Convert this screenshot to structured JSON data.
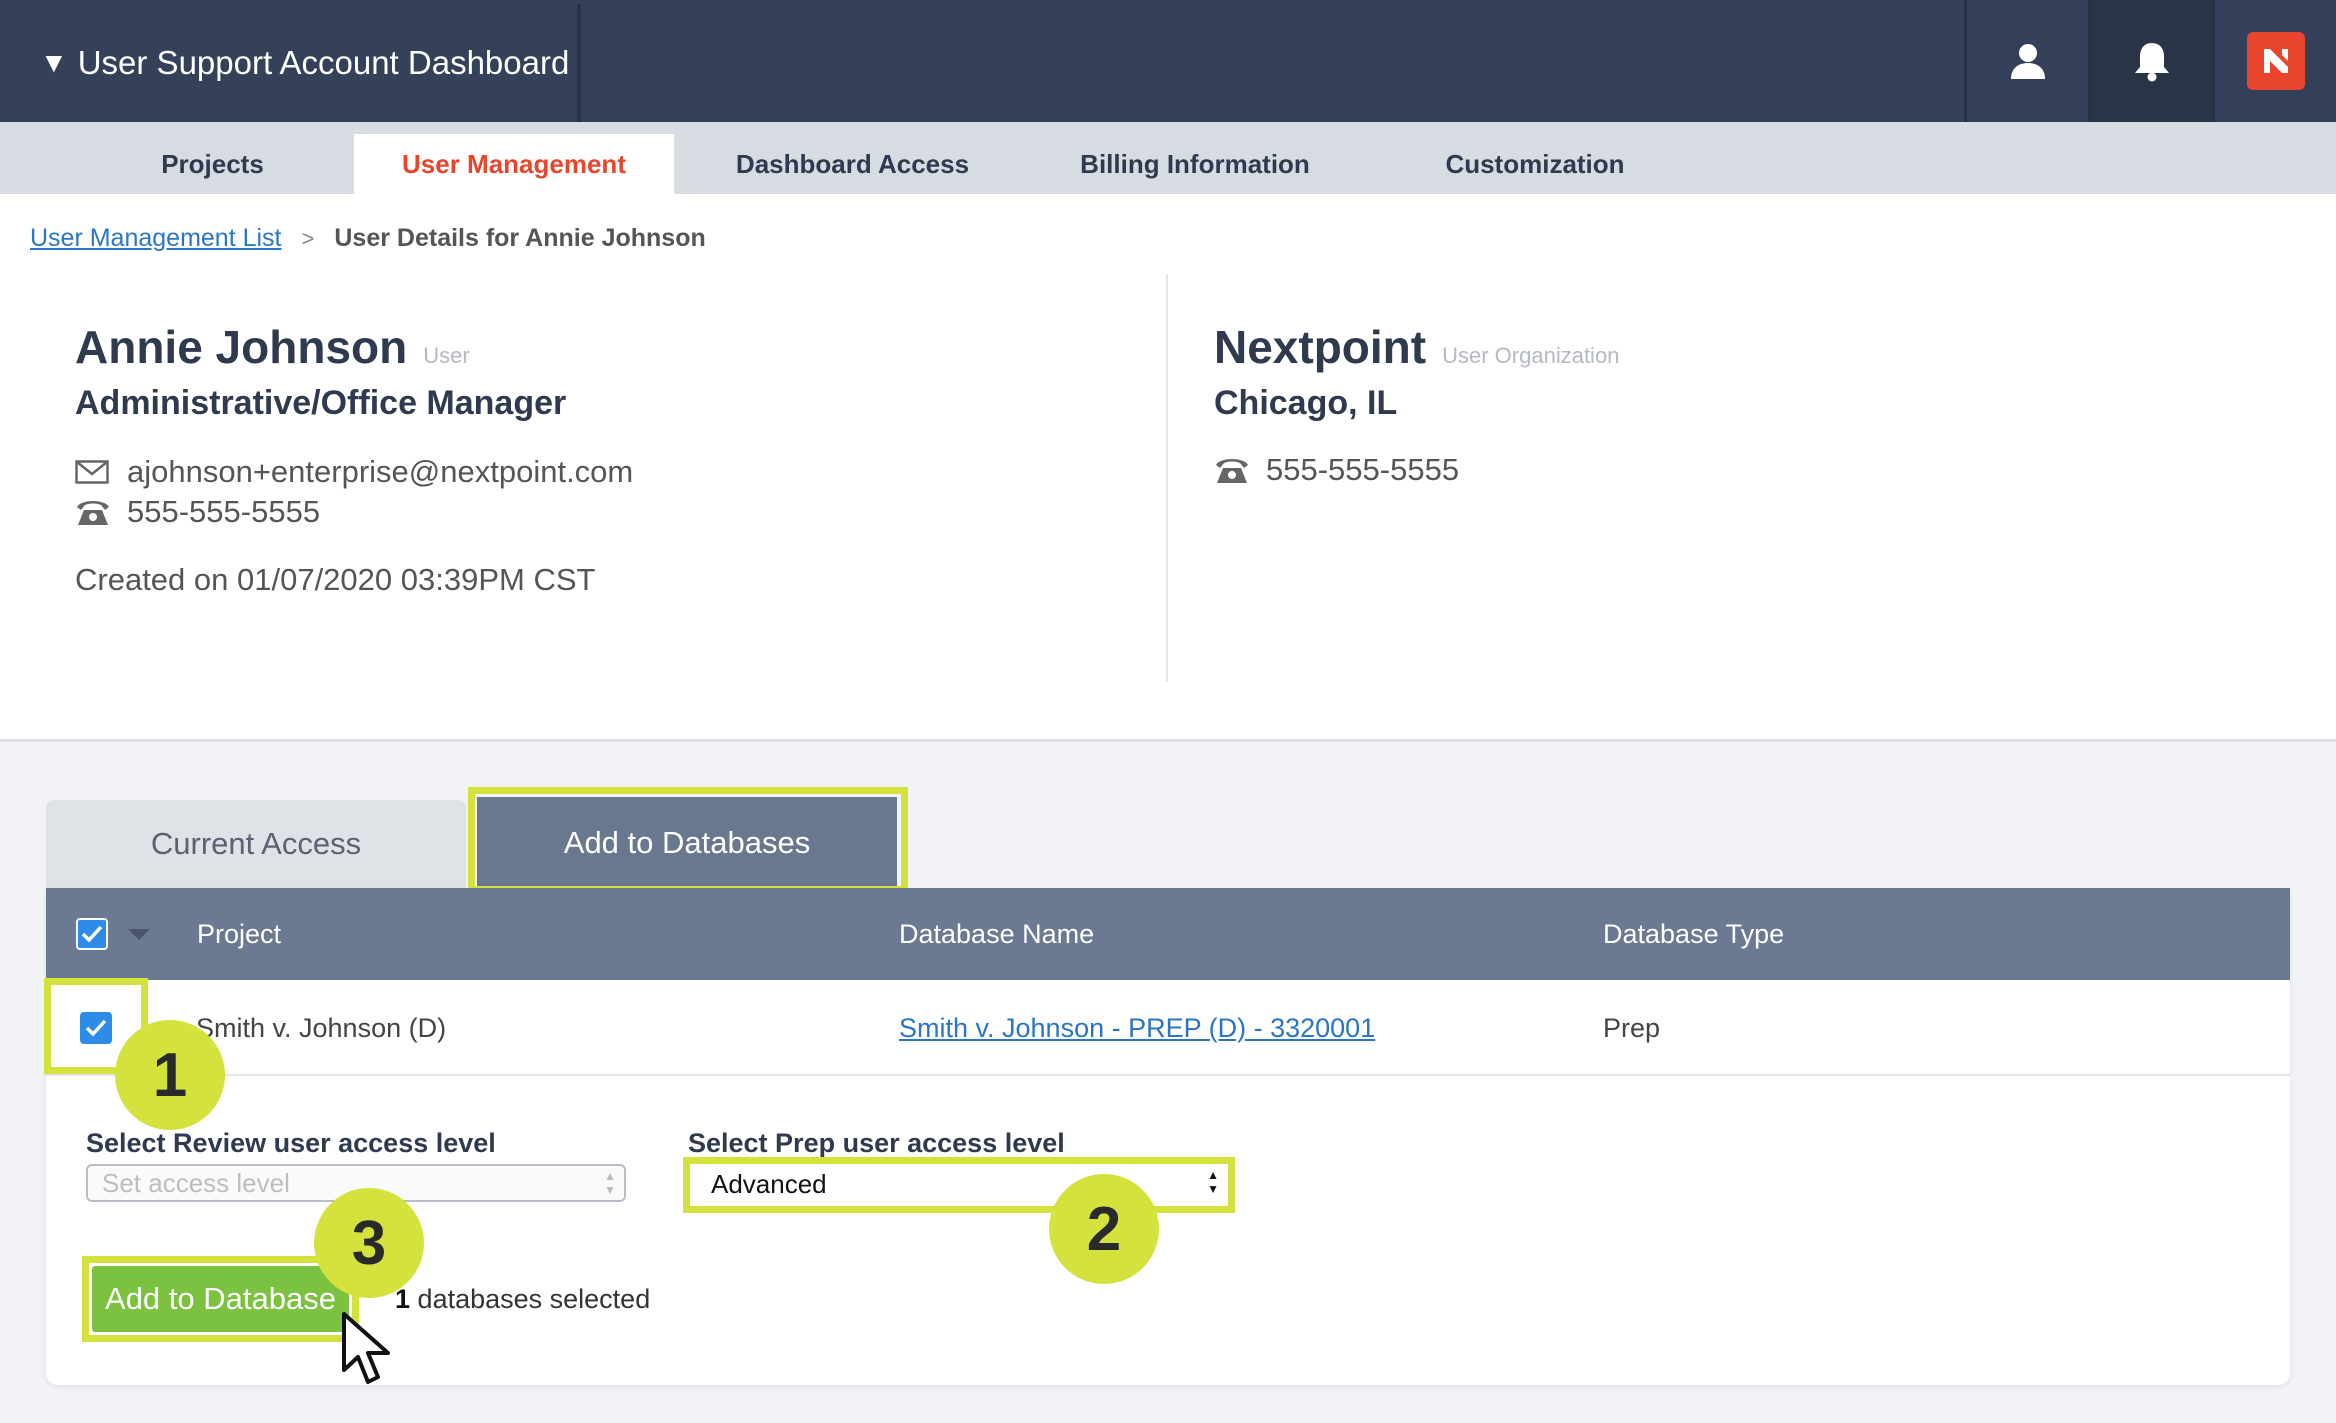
{
  "app": {
    "title": "User Support Account Dashboard",
    "title_caret": "▼",
    "header_icons": [
      "user-icon",
      "bell-icon",
      "nextpoint-logo-icon"
    ],
    "accent_color": "#e8452c"
  },
  "nav": {
    "tabs": [
      {
        "label": "Projects",
        "active": false
      },
      {
        "label": "User Management",
        "active": true
      },
      {
        "label": "Dashboard Access",
        "active": false
      },
      {
        "label": "Billing Information",
        "active": false
      },
      {
        "label": "Customization",
        "active": false
      }
    ]
  },
  "breadcrumb": {
    "link": "User Management List",
    "separator": ">",
    "current": "User Details for Annie Johnson"
  },
  "user": {
    "name": "Annie Johnson",
    "role_label": "User",
    "title": "Administrative/Office Manager",
    "email": "ajohnson+enterprise@nextpoint.com",
    "phone": "555-555-5555",
    "created": "Created on 01/07/2020 03:39PM CST"
  },
  "organization": {
    "name": "Nextpoint",
    "role_label": "User Organization",
    "location": "Chicago, IL",
    "phone": "555-555-5555"
  },
  "access_tabs": {
    "current": "Current Access",
    "add": "Add to Databases"
  },
  "table": {
    "headers": [
      "Project",
      "Database Name",
      "Database Type"
    ],
    "rows": [
      {
        "project": "Smith v. Johnson (D)",
        "database": "Smith v. Johnson - PREP (D) - 3320001",
        "type": "Prep",
        "checked": true
      }
    ]
  },
  "form": {
    "review_label": "Select Review user access level",
    "review_placeholder": "Set access level",
    "prep_label": "Select Prep user access level",
    "prep_value": "Advanced",
    "button": "Add to Database",
    "count": "1",
    "count_suffix": "databases selected"
  },
  "annotations": [
    "1",
    "2",
    "3"
  ],
  "highlight_color": "#d5e13c"
}
